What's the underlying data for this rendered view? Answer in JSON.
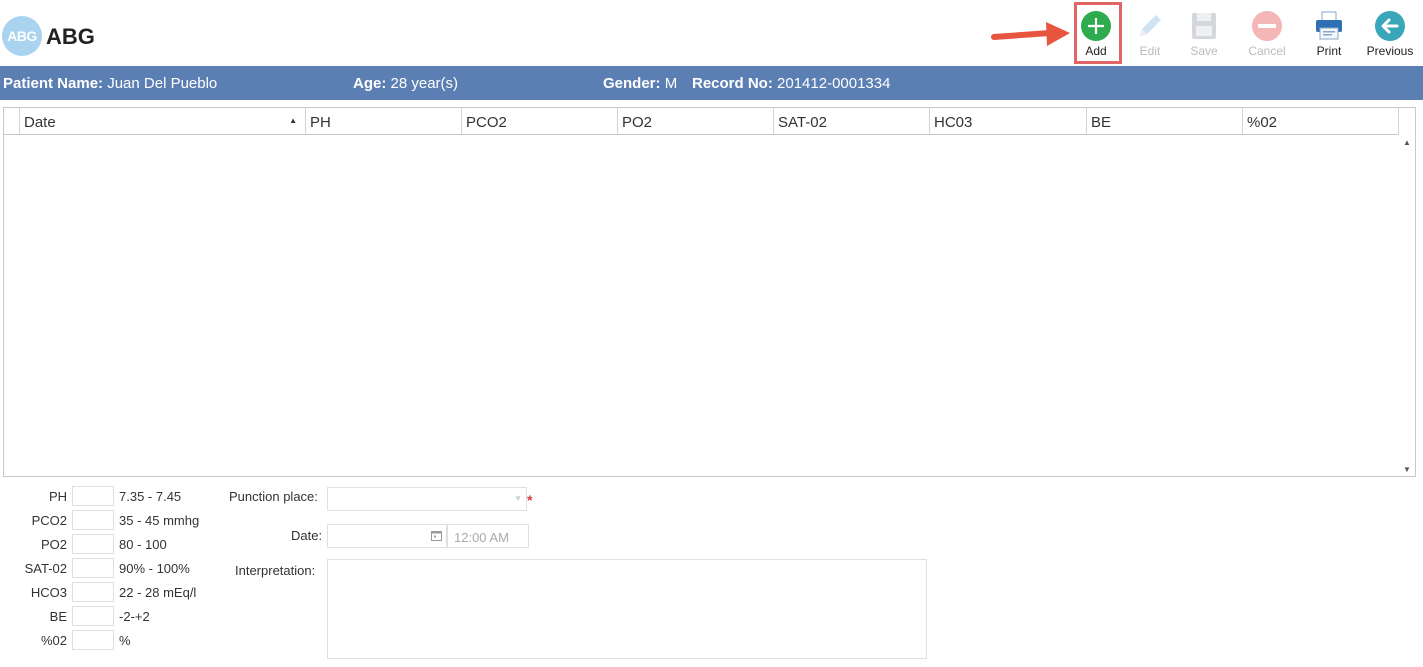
{
  "app": {
    "logo_text": "ABG",
    "title": "ABG"
  },
  "toolbar": {
    "add_label": "Add",
    "edit_label": "Edit",
    "save_label": "Save",
    "cancel_label": "Cancel",
    "print_label": "Print",
    "previous_label": "Previous"
  },
  "patient": {
    "name_label": "Patient Name:",
    "name": "Juan Del Pueblo",
    "age_label": "Age:",
    "age": "28 year(s)",
    "gender_label": "Gender:",
    "gender": "M",
    "record_label": "Record No:",
    "record": "201412-0001334"
  },
  "grid": {
    "columns": [
      "Date",
      "PH",
      "PCO2",
      "PO2",
      "SAT-02",
      "HC03",
      "BE",
      "%02"
    ]
  },
  "labs": [
    {
      "label": "PH",
      "range": "7.35 - 7.45"
    },
    {
      "label": "PCO2",
      "range": "35 - 45 mmhg"
    },
    {
      "label": "PO2",
      "range": "80 - 100"
    },
    {
      "label": "SAT-02",
      "range": "90% - 100%"
    },
    {
      "label": "HCO3",
      "range": "22 - 28 mEq/l"
    },
    {
      "label": "BE",
      "range": "-2-+2"
    },
    {
      "label": "%02",
      "range": "%"
    }
  ],
  "form": {
    "punction_label": "Punction place:",
    "date_label": "Date:",
    "time_placeholder": "12:00 AM",
    "interpretation_label": "Interpretation:",
    "required_mark": "*"
  },
  "colors": {
    "header_bar": "#5c7fb3",
    "add_green": "#2eaa4f",
    "highlight_red": "#e06666",
    "logo_blue": "#a9d3ef"
  }
}
